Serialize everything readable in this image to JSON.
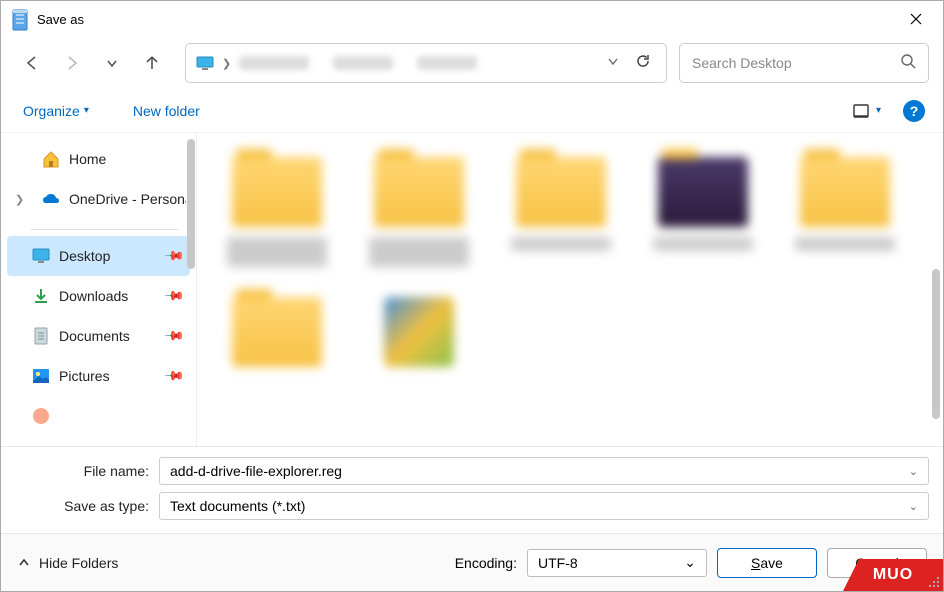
{
  "window": {
    "title": "Save as"
  },
  "nav": {
    "search_placeholder": "Search Desktop"
  },
  "toolbar": {
    "organize": "Organize",
    "new_folder": "New folder"
  },
  "sidebar": {
    "home": "Home",
    "onedrive": "OneDrive - Personal",
    "desktop": "Desktop",
    "downloads": "Downloads",
    "documents": "Documents",
    "pictures": "Pictures"
  },
  "form": {
    "filename_label": "File name:",
    "filename_value": "add-d-drive-file-explorer.reg",
    "type_label": "Save as type:",
    "type_value": "Text documents (*.txt)"
  },
  "footer": {
    "hide_folders": "Hide Folders",
    "encoding_label": "Encoding:",
    "encoding_value": "UTF-8",
    "save": "Save",
    "cancel": "Cancel"
  },
  "watermark": "MUO"
}
